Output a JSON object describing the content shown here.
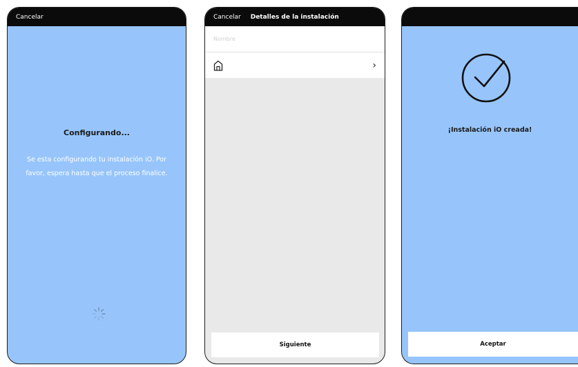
{
  "screen1": {
    "cancel_label": "Cancelar",
    "title": "Configurando...",
    "message": "Se esta configurando tu instalación iO. Por favor, espera hasta que el proceso finalice."
  },
  "screen2": {
    "cancel_label": "Cancelar",
    "title": "Detalles de la instalación",
    "name_placeholder": "Nombre",
    "next_button": "Siguiente"
  },
  "screen3": {
    "title": "¡Instalación iO creada!",
    "accept_button": "Aceptar"
  },
  "colors": {
    "screen_background": "#97c5fb",
    "topbar": "#0b0b0b",
    "form_background": "#e9e9e9"
  },
  "icons": [
    "spinner-icon",
    "house-icon",
    "chevron-right-icon",
    "checkmark-circle-icon"
  ]
}
